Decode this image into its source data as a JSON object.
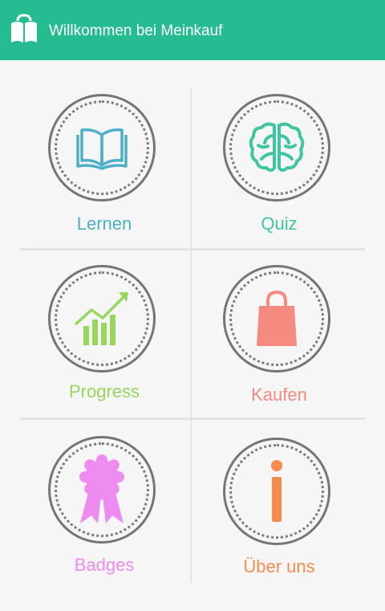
{
  "app_bar": {
    "title": "Willkommen bei Meinkauf",
    "background": "#26bc92",
    "logo_icon": "open-book-icon"
  },
  "menu": {
    "tiles": [
      {
        "label": "Lernen",
        "icon": "open-book-icon",
        "color": "#4bb0c8"
      },
      {
        "label": "Quiz",
        "icon": "brain-icon",
        "color": "#3fc5a3"
      },
      {
        "label": "Progress",
        "icon": "growth-chart-icon",
        "color": "#97d65a"
      },
      {
        "label": "Kaufen",
        "icon": "shopping-bag-icon",
        "color": "#f48a80"
      },
      {
        "label": "Badges",
        "icon": "award-ribbon-icon",
        "color": "#ee8bf0"
      },
      {
        "label": "Über uns",
        "icon": "info-icon",
        "color": "#f58c4e"
      }
    ]
  }
}
